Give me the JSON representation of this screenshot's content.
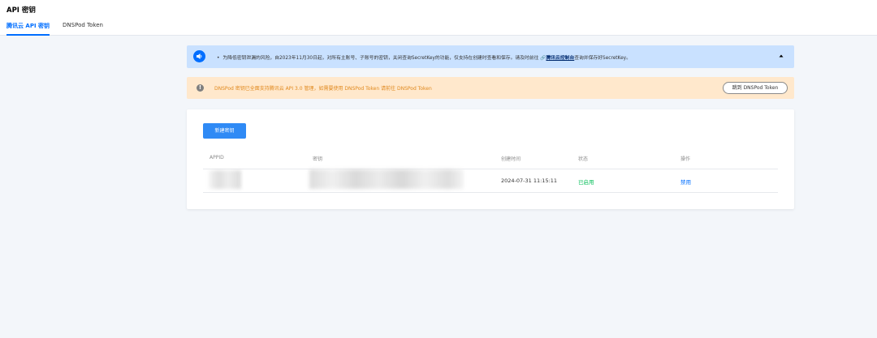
{
  "header": {
    "title": "API 密钥",
    "tabs": [
      {
        "label": "腾讯云 API 密钥",
        "active": true
      },
      {
        "label": "DNSPod Token",
        "active": false
      }
    ]
  },
  "notice": {
    "icon": "speaker-icon",
    "bullet": "•",
    "text": "为降低密钥泄漏的风险，自2023年11月30日起，对所有主账号、子账号的密钥，关闭查询SecretKey的功能，仅支持在创建时查看和保存。请及时前往",
    "link_label": "腾讯云控制台",
    "text_after": "查询并保存好SecretKey。",
    "collapse_icon": "triangle-up-icon"
  },
  "warning": {
    "icon": "info-icon",
    "text": "DNSPod 密钥已全面支持腾讯云 API 3.0 管理，如需要使用 DNSPod Token 请前往 DNSPod Token",
    "button_label": "跳到 DNSPod Token",
    "text_color": "#e0881d"
  },
  "keys": {
    "create_label": "新建密钥",
    "columns": [
      "APPID",
      "密钥",
      "创建时间",
      "状态",
      "操作"
    ],
    "rows": [
      {
        "created": "2024-07-31 11:15:11",
        "status": "已启用",
        "action": "禁用"
      }
    ]
  },
  "colors": {
    "accent": "#006eff",
    "button": "#2f8af5",
    "notice_bg": "#c9e1ff",
    "warning_bg": "#ffe8cc",
    "status_enabled": "#0abf5b"
  }
}
